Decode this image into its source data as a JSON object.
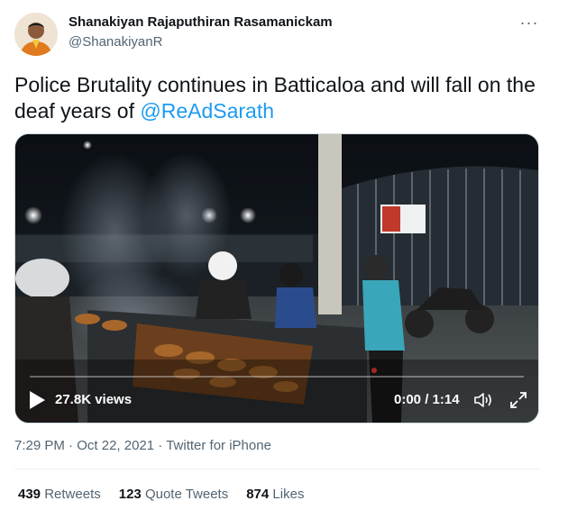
{
  "author": {
    "name": "Shanakiyan Rajaputhiran Rasamanickam",
    "handle": "@ShanakiyanR"
  },
  "more_label": "···",
  "tweet": {
    "text_before": "Police Brutality continues in Batticaloa and will fall on the deaf years of ",
    "mention": "@ReAdSarath"
  },
  "video": {
    "views": "27.8K views",
    "time": "0:00 / 1:14",
    "progress": 0,
    "play_icon": "play-icon",
    "volume_icon": "volume-icon",
    "fullscreen_icon": "fullscreen-icon"
  },
  "meta": {
    "time": "7:29 PM",
    "separator": " · ",
    "date": "Oct 22, 2021",
    "source": "Twitter for iPhone"
  },
  "stats": {
    "retweets_count": "439",
    "retweets_label": "Retweets",
    "quotes_count": "123",
    "quotes_label": "Quote Tweets",
    "likes_count": "874",
    "likes_label": "Likes"
  },
  "colors": {
    "accent": "#1d9bf0",
    "text": "#0f1419",
    "muted": "#536471"
  }
}
